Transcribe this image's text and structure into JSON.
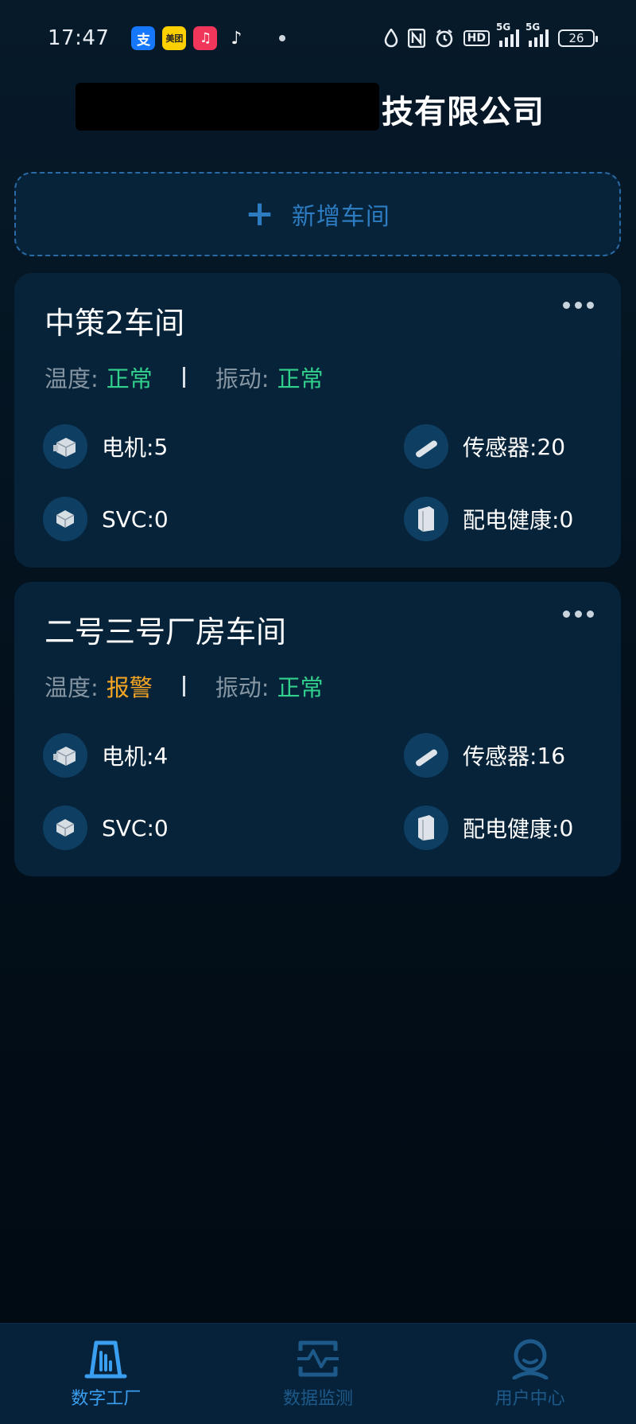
{
  "status_bar": {
    "time": "17:47",
    "apps": [
      "alipay-icon",
      "meituan-icon",
      "music-icon",
      "tiktok-icon"
    ],
    "alipay_glyph": "支",
    "meituan_glyph": "美团",
    "network_5g_label": "5G",
    "network_5g_label_2": "5G",
    "hd_label": "HD",
    "battery": "26"
  },
  "header": {
    "company_visible": "技有限公司"
  },
  "add_workshop": {
    "plus": "+",
    "label": "新增车间"
  },
  "labels": {
    "temperature": "温度:",
    "vibration": "振动:",
    "motor": "电机: ",
    "sensor": "传感器: ",
    "svc": "SVC: ",
    "power_health": "配电健康: "
  },
  "workshops": [
    {
      "name": "中策2车间",
      "temperature_status": "正常",
      "vibration_status": "正常",
      "motor_count": "5",
      "sensor_count": "20",
      "svc_count": "0",
      "power_health_count": "0"
    },
    {
      "name": "二号三号厂房车间",
      "temperature_status": "报警",
      "vibration_status": "正常",
      "motor_count": "4",
      "sensor_count": "16",
      "svc_count": "0",
      "power_health_count": "0"
    }
  ],
  "bottom_nav": {
    "items": [
      {
        "label": "数字工厂",
        "icon": "factory-icon",
        "active": true
      },
      {
        "label": "数据监测",
        "icon": "monitor-icon",
        "active": false
      },
      {
        "label": "用户中心",
        "icon": "user-icon",
        "active": false
      }
    ]
  },
  "colors": {
    "background": "#020f1a",
    "card": "#072339",
    "ok": "#31d08d",
    "warn": "#f7a623",
    "accent": "#2d7cc2",
    "nav_active": "#3a9ff0",
    "nav_inactive": "#1d5a8a"
  }
}
